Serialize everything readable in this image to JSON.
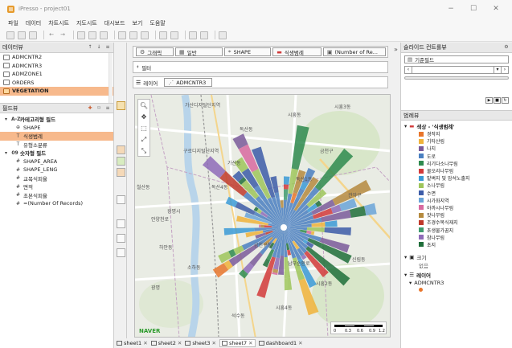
{
  "window": {
    "title": "iPresso - project01",
    "controls": [
      "−",
      "☐",
      "✕"
    ]
  },
  "menu": [
    "파일",
    "데이터",
    "차트시트",
    "지도시트",
    "대시보드",
    "보기",
    "도움말"
  ],
  "data_panel": {
    "title": "데이터뷰",
    "items": [
      {
        "label": "ADMCNTR2",
        "selected": false
      },
      {
        "label": "ADMCNTR3",
        "selected": false
      },
      {
        "label": "ADMZONE1",
        "selected": false
      },
      {
        "label": "ORDERS",
        "selected": false
      },
      {
        "label": "VEGETATION",
        "selected": true
      }
    ]
  },
  "field_panel": {
    "title": "필드뷰",
    "groups": [
      {
        "label": "카테고리형 필드",
        "icon": "A-Z",
        "fields": [
          {
            "label": "SHAPE",
            "icon": "⊕",
            "selected": false
          },
          {
            "label": "식생범례",
            "icon": "T",
            "selected": true
          },
          {
            "label": "유형소분류",
            "icon": "T",
            "selected": false
          }
        ]
      },
      {
        "label": "숫자형 필드",
        "icon": "09",
        "fields": [
          {
            "label": "SHAPE_AREA",
            "icon": "#",
            "selected": false
          },
          {
            "label": "SHAPE_LENG",
            "icon": "#",
            "selected": false
          },
          {
            "label": "교목식피율",
            "icon": "#",
            "selected": false
          },
          {
            "label": "면적",
            "icon": "#",
            "selected": false
          },
          {
            "label": "초본식피율",
            "icon": "#",
            "selected": false
          },
          {
            "label": "=(Number Of Records)",
            "icon": "#",
            "selected": false
          }
        ]
      }
    ]
  },
  "shelves": {
    "marks": [
      "그래픽",
      "일반",
      "SHAPE",
      "식생범례",
      "(Number of Re..."
    ],
    "filter_label": "필터",
    "layer_label": "레이어",
    "layer_value": "ADMCNTR3"
  },
  "map": {
    "labels": [
      "가산디지털단지역",
      "독산동",
      "구로디지털단지역",
      "금천구청",
      "시흥동",
      "시흥3동",
      "금천구",
      "광명시",
      "철산동",
      "하안동",
      "소하동",
      "독산1동",
      "독산4동",
      "가산동",
      "관악구",
      "신림동",
      "시흥2동",
      "시흥4동",
      "남부순환로",
      "광명",
      "석수동",
      "안양천로"
    ],
    "naver_logo": "NAVER",
    "scale_ticks": [
      "0",
      "0.3",
      "0.6",
      "0.9",
      "1.2"
    ]
  },
  "sheet_tabs": [
    "sheet1",
    "sheet2",
    "sheet3",
    "sheet7",
    "dashboard1"
  ],
  "right_panel": {
    "slide_title": "슬라이드 컨트롤뷰",
    "slide_field": "기준필드",
    "legend_title": "범례뷰",
    "legend_header": "색상 - '식생범례'",
    "legend_items": [
      {
        "label": "경작지",
        "color": "#e8752b"
      },
      {
        "label": "기타산림",
        "color": "#f0b33a"
      },
      {
        "label": "나지",
        "color": "#7a5a9a"
      },
      {
        "label": "도로",
        "color": "#4a7fc1"
      },
      {
        "label": "리기다소나무림",
        "color": "#2e8a4e"
      },
      {
        "label": "물오리나무림",
        "color": "#d23a3a"
      },
      {
        "label": "밭벼지 및 암석노출지",
        "color": "#3a9ad6"
      },
      {
        "label": "소나무림",
        "color": "#9ec55b"
      },
      {
        "label": "수면",
        "color": "#3c5ca8"
      },
      {
        "label": "시가화지역",
        "color": "#6aa4d8"
      },
      {
        "label": "아까시나무림",
        "color": "#d86aa0"
      },
      {
        "label": "잣나무림",
        "color": "#b58a3e"
      },
      {
        "label": "조경수목식재지",
        "color": "#c0392b"
      },
      {
        "label": "초생물가꿈지",
        "color": "#3f9b6e"
      },
      {
        "label": "참나무림",
        "color": "#8e6bb8"
      },
      {
        "label": "초지",
        "color": "#1f6e3a"
      }
    ],
    "size_label": "크기",
    "size_value": "없음",
    "layer_title": "레이어",
    "layer_item": "ADMCNTR3"
  }
}
